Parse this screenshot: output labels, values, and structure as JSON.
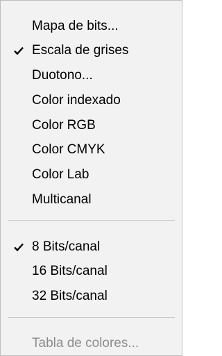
{
  "menu": {
    "groups": [
      {
        "items": [
          {
            "label": "Mapa de bits...",
            "checked": false,
            "enabled": true
          },
          {
            "label": "Escala de grises",
            "checked": true,
            "enabled": true
          },
          {
            "label": "Duotono...",
            "checked": false,
            "enabled": true
          },
          {
            "label": "Color indexado",
            "checked": false,
            "enabled": true
          },
          {
            "label": "Color RGB",
            "checked": false,
            "enabled": true
          },
          {
            "label": "Color CMYK",
            "checked": false,
            "enabled": true
          },
          {
            "label": "Color Lab",
            "checked": false,
            "enabled": true
          },
          {
            "label": "Multicanal",
            "checked": false,
            "enabled": true
          }
        ]
      },
      {
        "items": [
          {
            "label": "8 Bits/canal",
            "checked": true,
            "enabled": true
          },
          {
            "label": "16 Bits/canal",
            "checked": false,
            "enabled": true
          },
          {
            "label": "32 Bits/canal",
            "checked": false,
            "enabled": true
          }
        ]
      },
      {
        "items": [
          {
            "label": "Tabla de colores...",
            "checked": false,
            "enabled": false
          }
        ]
      }
    ],
    "colors": {
      "background": "#f2f2f2",
      "border": "#bdbdbd",
      "text": "#000000",
      "disabled_text": "#8c8c8c",
      "separator": "#c8c8c8"
    }
  }
}
